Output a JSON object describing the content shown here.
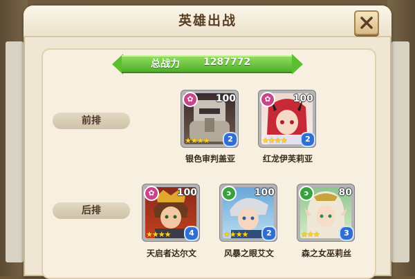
{
  "title": "英雄出战",
  "power": {
    "label": "总战力",
    "value": "1287772"
  },
  "rows": {
    "front": "前排",
    "back": "后排"
  },
  "heroes": [
    {
      "name": "银色审判盖亚",
      "level": "100",
      "rank": "2",
      "stars": "★★★★",
      "type": "pink",
      "type_icon": "lotus-icon"
    },
    {
      "name": "红龙伊芙莉亚",
      "level": "100",
      "rank": "2",
      "stars": "★★★★",
      "type": "pink",
      "type_icon": "lotus-icon"
    },
    {
      "name": "天启者达尔文",
      "level": "100",
      "rank": "4",
      "stars": "★★★★",
      "type": "pink",
      "type_icon": "lotus-icon"
    },
    {
      "name": "风暴之眼艾文",
      "level": "100",
      "rank": "2",
      "stars": "★★★★",
      "type": "green",
      "type_icon": "wind-icon"
    },
    {
      "name": "森之女巫莉丝",
      "level": "80",
      "rank": "3",
      "stars": "★★★",
      "type": "green",
      "type_icon": "wind-icon"
    }
  ],
  "colors": {
    "accent_green": "#5cbf30",
    "type_pink": "#c8458a",
    "type_green": "#3aa23d",
    "rank_blue": "#2f6fd1"
  }
}
